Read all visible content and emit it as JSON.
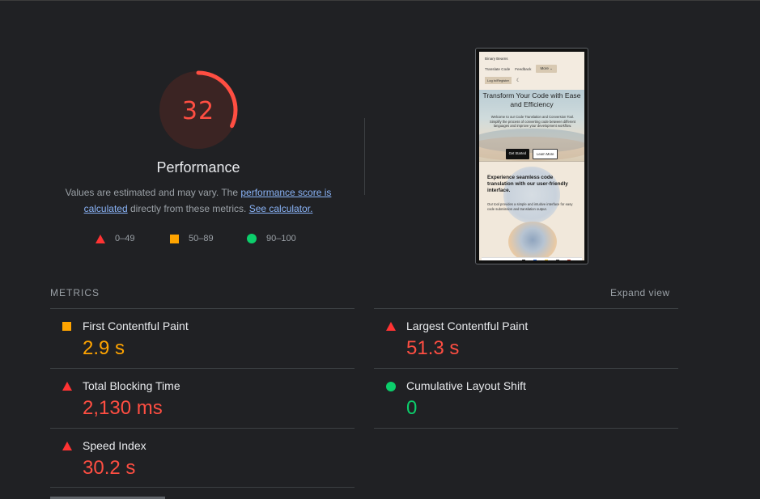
{
  "score": {
    "value": "32",
    "fraction": 0.32,
    "label": "Performance",
    "color": "#ff4e42"
  },
  "description": {
    "prefix": "Values are estimated and may vary. The ",
    "link1": "performance score is calculated",
    "middle": " directly from these metrics. ",
    "link2": "See calculator."
  },
  "legend": [
    {
      "shape": "triangle",
      "range": "0–49",
      "color": "#ff3333"
    },
    {
      "shape": "square",
      "range": "50–89",
      "color": "#ffa400"
    },
    {
      "shape": "circle",
      "range": "90–100",
      "color": "#0cce6b"
    }
  ],
  "screenshot": {
    "nav_brand": "Binary Beams",
    "nav_link1": "Translate Code",
    "nav_link2": "Feedback",
    "nav_more": "More ⌄",
    "nav_login": "Log in/Register",
    "hero_title": "Transform Your Code with Ease and Efficiency",
    "hero_text": "Welcome to our Code Translation and Conversion Tool. Simplify the process of converting code between different languages and improve your development workflow.",
    "btn_start": "Get Started",
    "btn_learn": "Learn More",
    "sec2_title": "Experience seamless code translation with our user-friendly interface.",
    "sec2_text": "Our tool provides a simple and intuitive interface for easy code submission and translation output."
  },
  "metrics": {
    "heading": "METRICS",
    "expand": "Expand view",
    "items": [
      {
        "title": "First Contentful Paint",
        "value": "2.9 s",
        "rating": "average"
      },
      {
        "title": "Largest Contentful Paint",
        "value": "51.3 s",
        "rating": "fail"
      },
      {
        "title": "Total Blocking Time",
        "value": "2,130 ms",
        "rating": "fail"
      },
      {
        "title": "Cumulative Layout Shift",
        "value": "0",
        "rating": "pass"
      },
      {
        "title": "Speed Index",
        "value": "30.2 s",
        "rating": "fail"
      }
    ]
  }
}
